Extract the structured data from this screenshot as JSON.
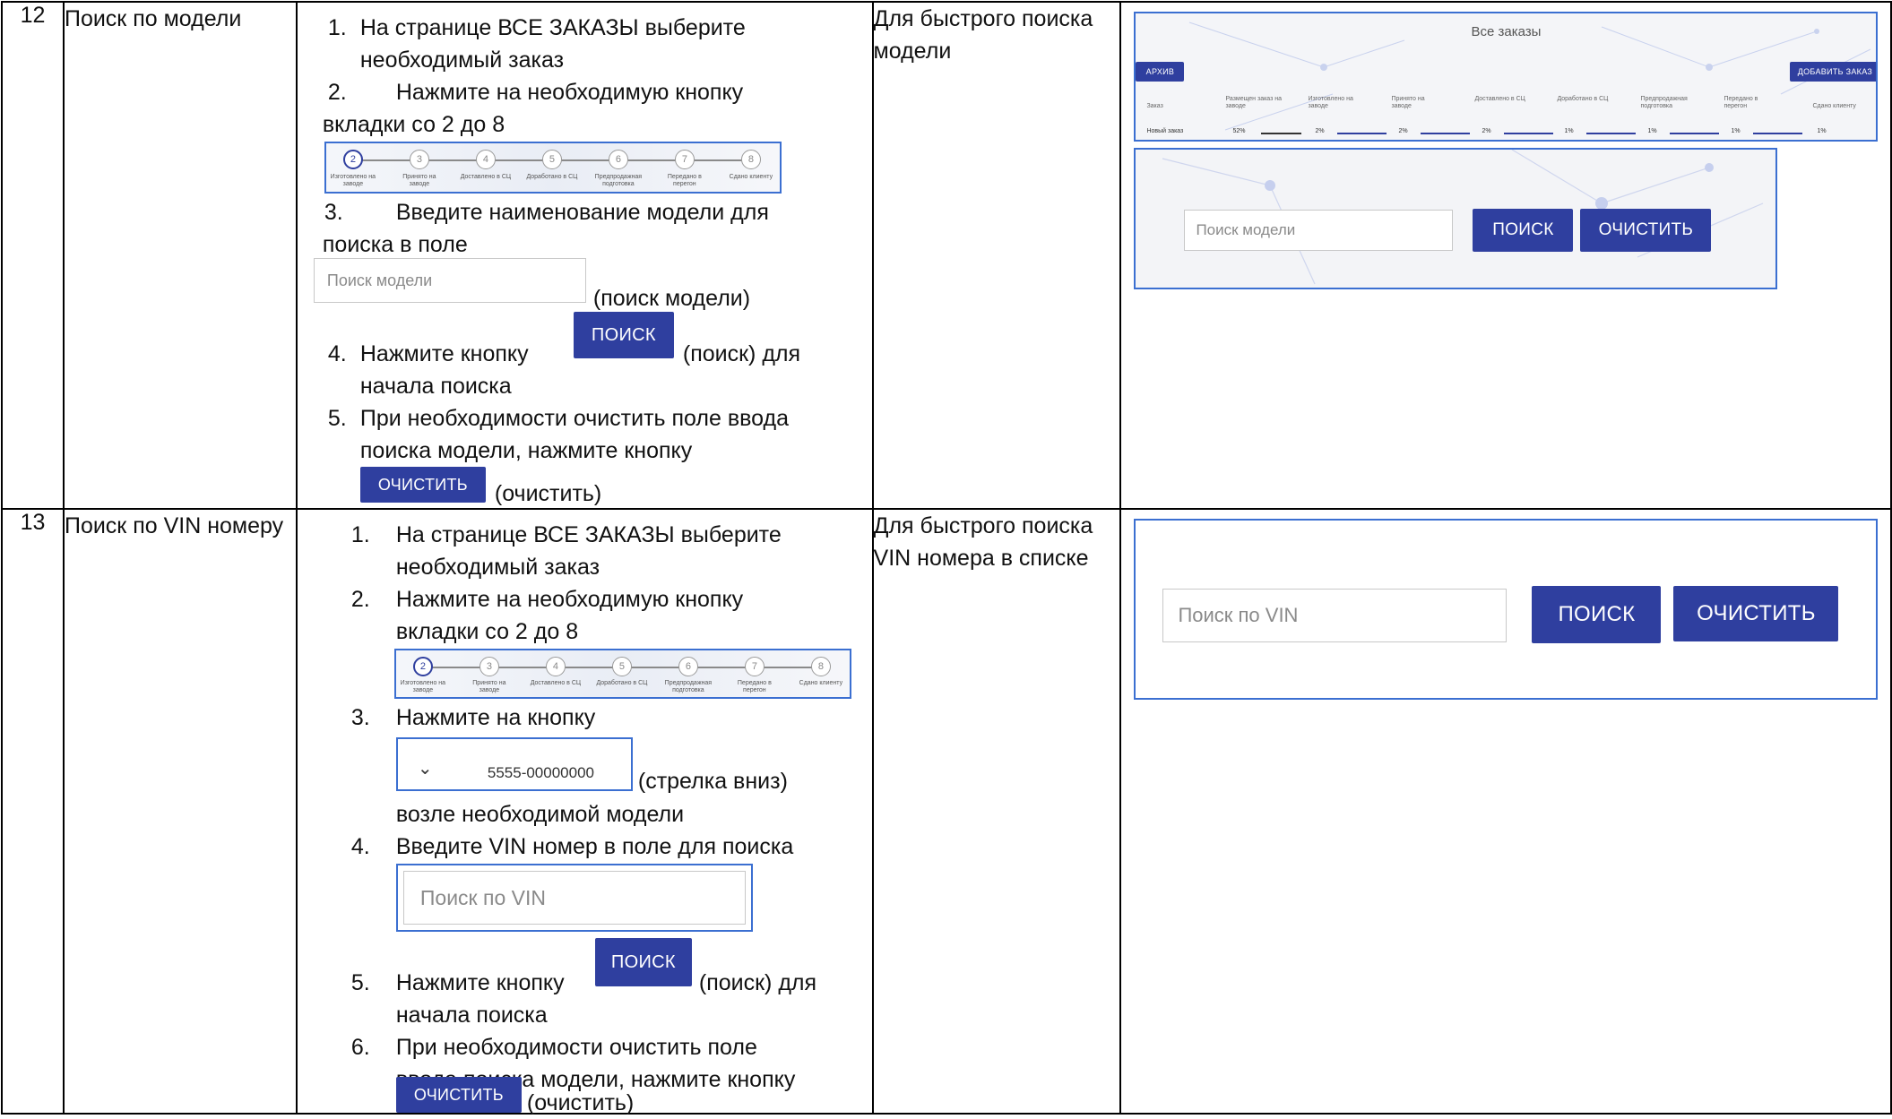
{
  "rows": [
    {
      "num": "12",
      "name": "Поиск по модели",
      "purpose": "Для быстрого поиска модели",
      "steps": {
        "s1_marker": "1.",
        "s1_line1": "На странице ВСЕ ЗАКАЗЫ выберите",
        "s1_line2": "необходимый заказ",
        "s2_marker": "2.",
        "s2_line1": "Нажмите на необходимую кнопку",
        "s2_line2": "вкладки со 2 до 8",
        "s3_marker": "3.",
        "s3_line1": "Введите наименование модели для",
        "s3_line2": "поиска в поле",
        "search_placeholder": "Поиск модели",
        "search_suffix": "(поиск модели)",
        "s4_marker": "4.",
        "s4_text_before": "Нажмите кнопку",
        "search_button": "ПОИСК",
        "s4_text_after": "(поиск) для",
        "s4_line2": "начала поиска",
        "s5_marker": "5.",
        "s5_line1": "При необходимости очистить поле ввода",
        "s5_line2": "поиска модели, нажмите кнопку",
        "clear_button": "ОЧИСТИТЬ",
        "clear_suffix": "(очистить)"
      },
      "screenshot_top": {
        "title": "Все заказы",
        "archive_button": "АРХИВ",
        "add_button": "ДОБАВИТЬ ЗАКАЗ",
        "columns": [
          "Заказ",
          "Размещен заказ на заводе",
          "Изготовлено на заводе",
          "Принято на заводе",
          "Доставлено в СЦ",
          "Доработано в СЦ",
          "Предпродажная подготовка",
          "Передано в перегон",
          "Сдано клиенту"
        ],
        "row": [
          "Новый заказ",
          "52%",
          "2%",
          "2%",
          "2%",
          "1%",
          "1%",
          "1%",
          "1%"
        ]
      },
      "screenshot_bottom": {
        "placeholder": "Поиск модели",
        "search_button": "ПОИСК",
        "clear_button": "ОЧИСТИТЬ"
      }
    },
    {
      "num": "13",
      "name": "Поиск по VIN номеру",
      "purpose": "Для быстрого поиска VIN номера в списке",
      "steps": {
        "s1_marker": "1.",
        "s1_line1": "На странице ВСЕ ЗАКАЗЫ выберите",
        "s1_line2": "необходимый заказ",
        "s2_marker": "2.",
        "s2_line1": "Нажмите на необходимую кнопку",
        "s2_line2": "вкладки со 2 до 8",
        "s3_marker": "3.",
        "s3_line1": "Нажмите на кнопку",
        "dropdown_value": "5555-00000000",
        "dropdown_suffix": "(стрелка вниз)",
        "s3_line3": "возле необходимой модели",
        "s4_marker": "4.",
        "s4_line1": "Введите VIN номер в поле для поиска",
        "vin_placeholder": "Поиск по VIN",
        "s5_marker": "5.",
        "s5_text_before": "Нажмите кнопку",
        "search_button": "ПОИСК",
        "s5_text_after": "(поиск) для",
        "s5_line2": "начала поиска",
        "s6_marker": "6.",
        "s6_line1": "При необходимости очистить поле",
        "s6_line2": "ввода поиска модели, нажмите кнопку",
        "clear_button": "ОЧИСТИТЬ",
        "clear_suffix": "(очистить)"
      },
      "screenshot": {
        "placeholder": "Поиск по VIN",
        "search_button": "ПОИСК",
        "clear_button": "ОЧИСТИТЬ"
      }
    }
  ],
  "progress_steps": [
    {
      "n": "2",
      "label": "Изготовлено на заводе"
    },
    {
      "n": "3",
      "label": "Принято на заводе"
    },
    {
      "n": "4",
      "label": "Доставлено в СЦ"
    },
    {
      "n": "5",
      "label": "Доработано в СЦ"
    },
    {
      "n": "6",
      "label": "Предпродажная подготовка"
    },
    {
      "n": "7",
      "label": "Передано в перегон"
    },
    {
      "n": "8",
      "label": "Сдано клиенту"
    }
  ],
  "colors": {
    "primary": "#2f3f9f",
    "frame_blue": "#3b6fd1"
  }
}
